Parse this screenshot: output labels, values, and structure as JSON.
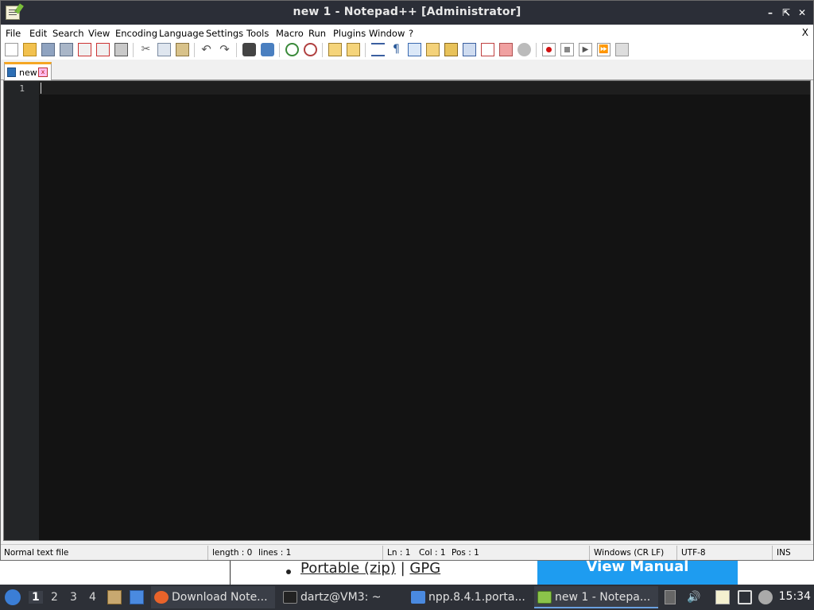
{
  "window": {
    "title": "new 1 - Notepad++ [Administrator]"
  },
  "menubar": {
    "items": [
      "File",
      "Edit",
      "Search",
      "View",
      "Encoding",
      "Language",
      "Settings",
      "Tools",
      "Macro",
      "Run",
      "Plugins",
      "Window",
      "?"
    ],
    "close_label": "X"
  },
  "toolbar": {
    "icons": [
      "new-file-icon",
      "open-file-icon",
      "save-icon",
      "save-all-icon",
      "close-icon",
      "close-all-icon",
      "print-icon",
      "cut-icon",
      "copy-icon",
      "paste-icon",
      "undo-icon",
      "redo-icon",
      "find-icon",
      "replace-icon",
      "zoom-in-icon",
      "zoom-out-icon",
      "sync-vertical-icon",
      "sync-horizontal-icon",
      "word-wrap-icon",
      "show-all-chars-icon",
      "indent-guide-icon",
      "user-lang-icon",
      "doc-map-icon",
      "doc-list-icon",
      "function-list-icon",
      "folder-workspace-icon",
      "monitoring-icon",
      "record-macro-icon",
      "stop-record-icon",
      "playback-icon",
      "run-multiple-icon",
      "save-macro-icon"
    ]
  },
  "tabs": [
    {
      "label": "new",
      "close": "x"
    }
  ],
  "editor": {
    "line_numbers": [
      "1"
    ],
    "content": ""
  },
  "statusbar": {
    "file_type": "Normal text file",
    "length": "length : 0",
    "lines": "lines : 1",
    "ln": "Ln : 1",
    "col": "Col : 1",
    "pos": "Pos : 1",
    "eol": "Windows (CR LF)",
    "encoding": "UTF-8",
    "mode": "INS"
  },
  "background_page": {
    "link_portable": "Portable (zip)",
    "separator": "|",
    "link_gpg": "GPG",
    "view_manual": "View Manual"
  },
  "taskbar": {
    "workspaces": [
      "1",
      "2",
      "3",
      "4"
    ],
    "tasks": [
      {
        "label": "Download Note...",
        "icon": "firefox-icon"
      },
      {
        "label": "dartz@VM3: ~",
        "icon": "terminal-icon"
      },
      {
        "label": "npp.8.4.1.porta...",
        "icon": "folder-icon"
      },
      {
        "label": "new 1 - Notepa...",
        "icon": "notepadpp-icon"
      }
    ],
    "clock": "15:34"
  },
  "colors": {
    "accent_tab": "#f5a623",
    "editor_bg": "#131313",
    "view_manual_bg": "#1e9cf0",
    "titlebar_bg": "#2b2e37"
  }
}
